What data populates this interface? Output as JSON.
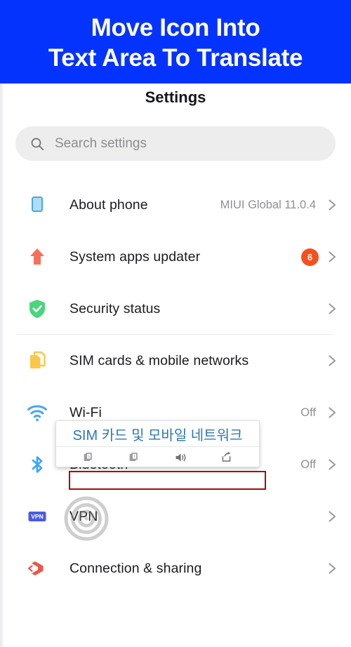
{
  "banner": {
    "line1": "Move Icon Into",
    "line2": "Text Area To Translate",
    "bg_color": "#0533FE",
    "text_color": "#FFFFFF"
  },
  "header": {
    "title": "Settings"
  },
  "search": {
    "placeholder": "Search settings",
    "icon": "search-icon"
  },
  "settings_list": [
    {
      "label": "About phone",
      "value": "MIUI Global 11.0.4",
      "badge": "",
      "icon": "phone-outline-icon",
      "icon_color": "#4BA8DE",
      "chevron": "chevron-right-icon"
    },
    {
      "label": "System apps updater",
      "value": "",
      "badge": "6",
      "badge_color": "#F4511E",
      "icon": "up-arrow-icon",
      "icon_color": "#F4705A",
      "chevron": "chevron-right-icon"
    },
    {
      "label": "Security status",
      "value": "",
      "badge": "",
      "icon": "shield-check-icon",
      "icon_color": "#4BD57F",
      "chevron": "chevron-right-icon"
    },
    {
      "label": "SIM cards & mobile networks",
      "value": "",
      "badge": "",
      "icon": "sim-cards-icon",
      "icon_color": "#FCC74A",
      "chevron": "chevron-right-icon"
    },
    {
      "label": "Wi-Fi",
      "value": "Off",
      "badge": "",
      "icon": "wifi-icon",
      "icon_color": "#4AA7F0",
      "chevron": "chevron-right-icon"
    },
    {
      "label": "Bluetooth",
      "value": "Off",
      "badge": "",
      "icon": "bluetooth-icon",
      "icon_color": "#3BA7F5",
      "chevron": "chevron-right-icon"
    },
    {
      "label": "VPN",
      "value": "",
      "badge": "",
      "icon": "vpn-icon",
      "icon_color": "#4A5BE0",
      "icon_text": "VPN",
      "chevron": "chevron-right-icon"
    },
    {
      "label": "Connection & sharing",
      "value": "",
      "badge": "",
      "icon": "connection-sharing-icon",
      "icon_color": "#E8584A",
      "chevron": "chevron-right-icon"
    }
  ],
  "translate_popup": {
    "translated_text": "SIM 카드 및 모바일 네트워크",
    "text_color": "#2D77B5",
    "tools": [
      {
        "name": "copy-source-icon"
      },
      {
        "name": "copy-translation-icon"
      },
      {
        "name": "speak-aloud-icon"
      },
      {
        "name": "share-icon"
      }
    ]
  },
  "highlight": {
    "target_label": "SIM cards & mobile networks",
    "border_color": "#A60B0B"
  },
  "touch_marker": {
    "name": "touch-target-marker",
    "color": "#8B8B8B"
  }
}
